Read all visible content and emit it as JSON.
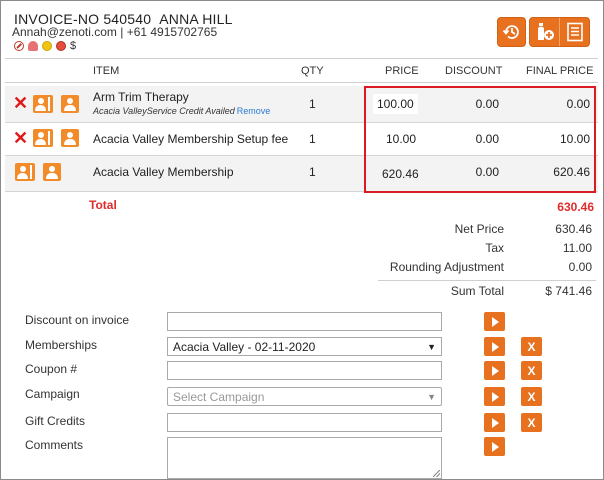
{
  "header": {
    "invoice_no": "INVOICE-NO 540540",
    "customer_name": "ANNA HILL",
    "contact": "Annah@zenoti.com | +61 4915702765",
    "status_icons": [
      "ban-icon",
      "person-alert-icon",
      "yellow-dot-icon",
      "red-dot-icon",
      "dollar-icon"
    ],
    "status_dollar": "$"
  },
  "table": {
    "columns": {
      "item": "ITEM",
      "qty": "QTY",
      "price": "PRICE",
      "discount": "DISCOUNT",
      "final_price": "FINAL PRICE"
    },
    "rows": [
      {
        "item": "Arm Trim Therapy",
        "note": "Acacia ValleyService Credit Availed",
        "note_link": "Remove",
        "qty": "1",
        "price": "100.00",
        "discount": "0.00",
        "final_price": "0.00"
      },
      {
        "item": "Acacia Valley Membership Setup fee",
        "qty": "1",
        "price": "10.00",
        "discount": "0.00",
        "final_price": "10.00"
      },
      {
        "item": "Acacia Valley Membership",
        "qty": "1",
        "price": "620.46",
        "discount": "0.00",
        "final_price": "620.46"
      }
    ]
  },
  "totals": {
    "total_label": "Total",
    "total_value": "630.46",
    "net_price_label": "Net Price",
    "net_price": "630.46",
    "tax_label": "Tax",
    "tax": "11.00",
    "rounding_label": "Rounding Adjustment",
    "rounding": "0.00",
    "sum_total_label": "Sum Total",
    "sum_total": "$ 741.46"
  },
  "form": {
    "discount_label": "Discount on invoice",
    "discount_value": "",
    "memberships_label": "Memberships",
    "memberships_value": "Acacia Valley - 02-11-2020",
    "coupon_label": "Coupon #",
    "coupon_value": "",
    "campaign_label": "Campaign",
    "campaign_placeholder": "Select Campaign",
    "gift_credits_label": "Gift Credits",
    "gift_credits_value": "",
    "comments_label": "Comments",
    "comments_value": "",
    "clear_label": "X"
  },
  "colors": {
    "accent": "#e8711f",
    "highlight": "#d91c23",
    "total": "#e02b2b",
    "link": "#2a7bd1"
  }
}
